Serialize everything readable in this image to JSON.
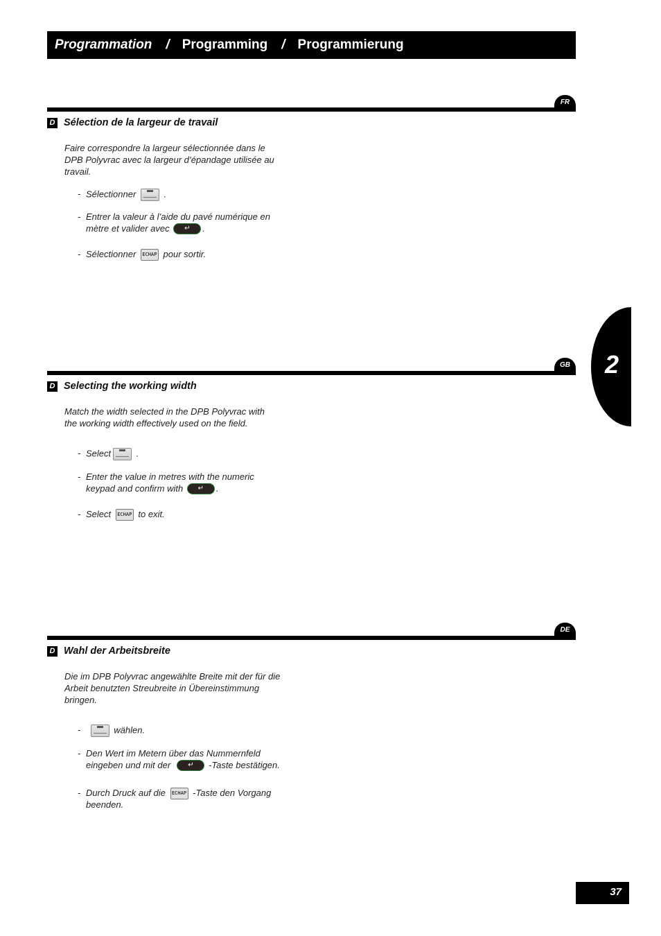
{
  "header": {
    "title_fr": "Programmation",
    "separator": "/",
    "title_gb": "Programming",
    "title_de": "Programmierung"
  },
  "chapter": {
    "number": "2"
  },
  "page_number": "37",
  "sections": [
    {
      "lang": "FR",
      "badge": "D",
      "title": "Sélection de la largeur de travail",
      "intro": [
        "Faire correspondre la largeur sélectionnée dans le",
        "DPB Polyvrac avec la largeur d’épandage utilisée au",
        "travail."
      ],
      "step1": {
        "dash": "-",
        "before": "Sélectionner",
        "after": "."
      },
      "step2": {
        "dash": "-",
        "line1": "Entrer la valeur à l’aide du pavé numérique en",
        "line2_before": "mètre et valider avec",
        "line2_after": "."
      },
      "step3": {
        "dash": "-",
        "before": "Sélectionner",
        "after": "pour sortir."
      }
    },
    {
      "lang": "GB",
      "badge": "D",
      "title": "Selecting the working width",
      "intro": [
        "Match the width selected in the DPB Polyvrac with",
        "the working width effectively used on the field."
      ],
      "step1": {
        "dash": "-",
        "before": "Select",
        "after": "."
      },
      "step2": {
        "dash": "-",
        "line1": "Enter the value in metres with the numeric",
        "line2_before": "keypad and confirm with",
        "line2_after": "."
      },
      "step3": {
        "dash": "-",
        "before": "Select",
        "after": "to exit."
      }
    },
    {
      "lang": "DE",
      "badge": "D",
      "title": "Wahl der Arbeitsbreite",
      "intro": [
        "Die im DPB Polyvrac angewählte Breite mit der für die",
        "Arbeit benutzten Streubreite in Übereinstimmung",
        "bringen."
      ],
      "step1": {
        "dash": "-",
        "before": "",
        "after": "wählen."
      },
      "step2": {
        "dash": "-",
        "line1": "Den Wert im Metern über das Nummernfeld",
        "line2_before": "eingeben und mit der",
        "line2_after": "-Taste bestätigen."
      },
      "step3": {
        "dash": "-",
        "before": "Durch Druck auf die",
        "after": "-Taste den Vorgang",
        "line2": "beenden."
      }
    }
  ],
  "keys": {
    "enter_icon": "↵",
    "echap_label": "ECHAP",
    "width_icon": "working-width-key-icon"
  }
}
